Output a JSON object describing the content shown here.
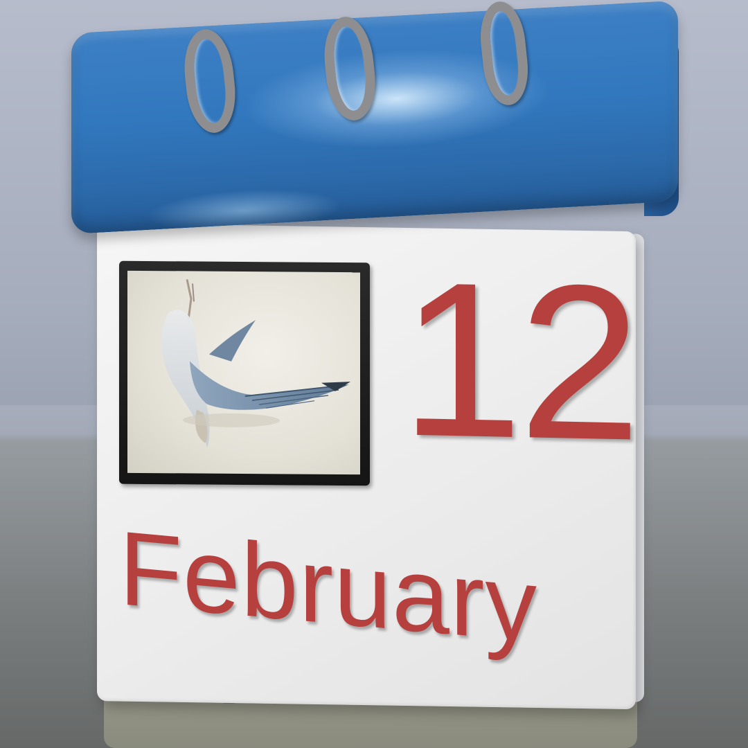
{
  "calendar": {
    "day": "12",
    "month": "February",
    "colors": {
      "header": "#3278be",
      "page": "#ececec",
      "text": "#b6403e",
      "rings": "#8e8e90",
      "frame": "#1c1c1c"
    },
    "picture": {
      "icon": "dead-bird-painting"
    }
  }
}
